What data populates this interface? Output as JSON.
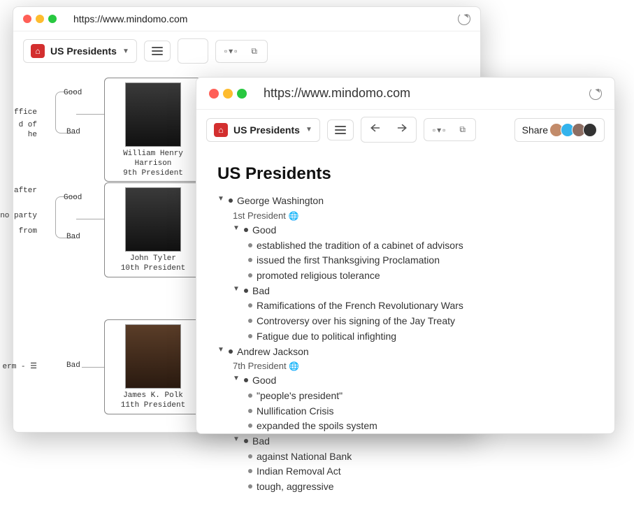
{
  "url": "https://www.mindomo.com",
  "doc_title": "US Presidents",
  "share_label": "Share",
  "back_map": {
    "nodes": [
      {
        "name": "William Henry Harrison",
        "ord": "9th President"
      },
      {
        "name": "John Tyler",
        "ord": "10th President"
      },
      {
        "name": "James K. Polk",
        "ord": "11th President"
      }
    ],
    "branch_labels": {
      "good": "Good",
      "bad": "Bad"
    },
    "left_snips": {
      "a": "ffice",
      "b": "d of",
      "c": "he",
      "d": "after",
      "e": "no party",
      "f": "from",
      "g": "erm - ☰"
    }
  },
  "outline": {
    "title": "US Presidents",
    "presidents": [
      {
        "name": "George Washington",
        "ord": "1st President",
        "good": [
          "established the tradition of a cabinet of advisors",
          "issued the first Thanksgiving Proclamation",
          "promoted religious tolerance"
        ],
        "bad": [
          "Ramifications of the French Revolutionary Wars",
          "Controversy over his signing of the Jay Treaty",
          "Fatigue due to political infighting"
        ]
      },
      {
        "name": "Andrew Jackson",
        "ord": "7th President",
        "good": [
          "\"people's president\"",
          "Nullification Crisis",
          "expanded the spoils system"
        ],
        "bad": [
          "against National Bank",
          "Indian Removal Act",
          "tough, aggressive"
        ]
      }
    ],
    "section_labels": {
      "good": "Good",
      "bad": "Bad"
    }
  }
}
